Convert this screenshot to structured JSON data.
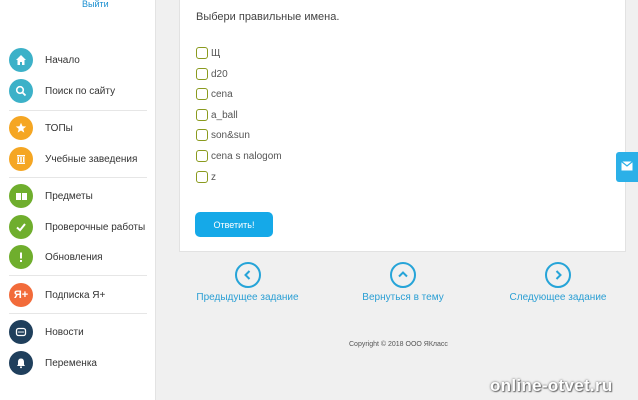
{
  "sidebar": {
    "logout_label": "Выйти",
    "items": [
      {
        "label": "Начало",
        "icon": "home-icon",
        "color": "#3cb1c8"
      },
      {
        "label": "Поиск по сайту",
        "icon": "search-icon",
        "color": "#3cb1c8"
      },
      {
        "label": "ТОПы",
        "icon": "star-icon",
        "color": "#f5a623"
      },
      {
        "label": "Учебные заведения",
        "icon": "building-icon",
        "color": "#f5a623"
      },
      {
        "label": "Предметы",
        "icon": "book-icon",
        "color": "#6fae2d"
      },
      {
        "label": "Проверочные работы",
        "icon": "check-icon",
        "color": "#6fae2d"
      },
      {
        "label": "Обновления",
        "icon": "exclamation-icon",
        "color": "#6fae2d"
      },
      {
        "label": "Подписка Я+",
        "icon": "ya-plus-icon",
        "color": "#f26b3a",
        "icon_text": "Я+"
      },
      {
        "label": "Новости",
        "icon": "chat-icon",
        "color": "#1f3f5c"
      },
      {
        "label": "Переменка",
        "icon": "bell-icon",
        "color": "#1f3f5c"
      }
    ]
  },
  "task": {
    "question": "Выбери правильные имена.",
    "options": [
      "Щ",
      "d20",
      "cena",
      "a_ball",
      "son&sun",
      "cena s nalogom",
      "z"
    ],
    "answer_button": "Ответить!"
  },
  "navigation": {
    "prev": "Предыдущее задание",
    "back": "Вернуться в тему",
    "next": "Следующее задание"
  },
  "footer": {
    "copyright": "Copyright © 2018 ООО ЯКласс"
  },
  "feedback_icon": "mail-icon",
  "watermark": "online-otvet.ru",
  "colors": {
    "accent": "#15a9e8",
    "link": "#2b9fd4",
    "checkbox_border": "#8a9a1e"
  }
}
